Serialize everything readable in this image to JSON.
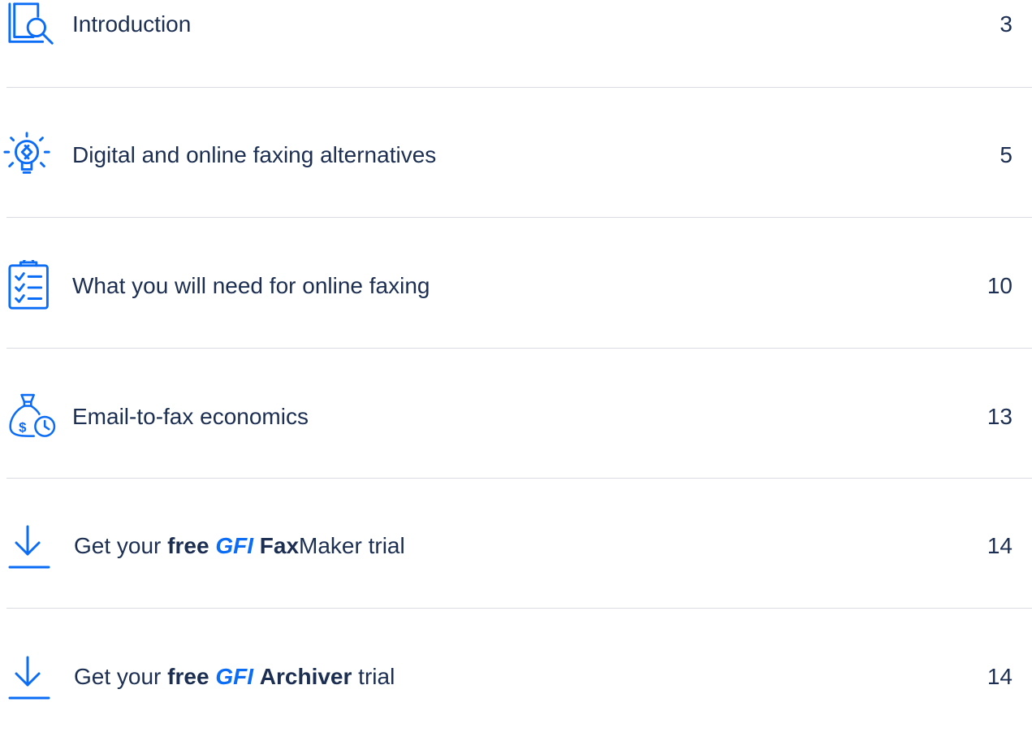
{
  "toc": {
    "items": [
      {
        "icon": "book-search-icon",
        "label": "Introduction",
        "page": "3"
      },
      {
        "icon": "lightbulb-icon",
        "label": "Digital and online faxing alternatives",
        "page": "5"
      },
      {
        "icon": "checklist-clipboard-icon",
        "label": "What you will need for online faxing",
        "page": "10"
      },
      {
        "icon": "money-bag-clock-icon",
        "label": "Email-to-fax economics",
        "page": "13"
      },
      {
        "icon": "download-icon",
        "label_parts": {
          "pre": "Get your ",
          "free": "free",
          "brand": "GFI",
          "product_bold": "Fax",
          "product_rest": "Maker",
          "post": " trial"
        },
        "page": "14"
      },
      {
        "icon": "download-icon",
        "label_parts": {
          "pre": "Get your ",
          "free": "free",
          "brand": "GFI",
          "product_bold": "Archiver",
          "post": " trial"
        },
        "page": "14"
      }
    ]
  },
  "colors": {
    "accent": "#0b6cf5",
    "text": "#1c2f52",
    "divider": "#d9dde3"
  }
}
